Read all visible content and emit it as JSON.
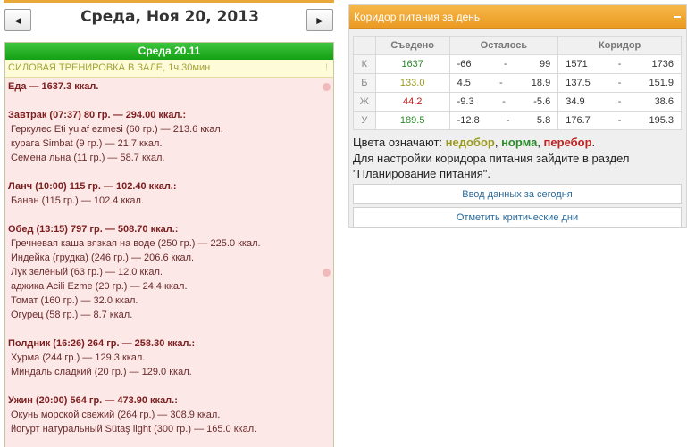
{
  "nav": {
    "prev_label": "◄",
    "next_label": "►",
    "date_title": "Среда, Ноя 20, 2013"
  },
  "day": {
    "header": "Среда 20.11",
    "workout": "СИЛОВАЯ ТРЕНИРОВКА В ЗАЛЕ, 1ч 30мин",
    "workout_mark": "!",
    "total": "Еда — 1637.3 ккал.",
    "meals": [
      {
        "title": "Завтрак (07:37) 80 гр. — 294.00 ккал.:",
        "items": [
          "Геркулес Eti yulaf ezmesi (60 гр.) — 213.6 ккал.",
          "курага Simbat (9 гр.) — 21.7 ккал.",
          "Семена льна (11 гр.) — 58.7 ккал."
        ]
      },
      {
        "title": "Ланч (10:00) 115 гр. — 102.40 ккал.:",
        "items": [
          "Банан (115 гр.) — 102.4 ккал."
        ]
      },
      {
        "title": "Обед (13:15) 797 гр. — 508.70 ккал.:",
        "items": [
          "Гречневая каша вязкая на воде (250 гр.) — 225.0 ккал.",
          "Индейка (грудка) (246 гр.) — 206.6 ккал.",
          "Лук зелёный (63 гр.) — 12.0 ккал.",
          "аджика Acili Ezme (20 гр.) — 24.4 ккал.",
          "Томат (160 гр.) — 32.0 ккал.",
          "Огурец (58 гр.) — 8.7 ккал."
        ]
      },
      {
        "title": "Полдник (16:26) 264 гр. — 258.30 ккал.:",
        "items": [
          "Хурма (244 гр.) — 129.3 ккал.",
          "Миндаль сладкий (20 гр.) — 129.0 ккал."
        ]
      },
      {
        "title": "Ужин (20:00) 564 гр. — 473.90 ккал.:",
        "items": [
          "Окунь морской свежий (264 гр.) — 308.9 ккал.",
          "йогурт натуральный Sütaş light (300 гр.) — 165.0 ккал."
        ]
      }
    ]
  },
  "corridor": {
    "title": "Коридор питания за день",
    "headers": {
      "eaten": "Съедено",
      "remaining": "Осталось",
      "corridor": "Коридор"
    },
    "rows": [
      {
        "label": "К",
        "eaten": "1637",
        "eaten_color": "#2a8a2a",
        "rem_min": "-66",
        "rem_max": "99",
        "cor_min": "1571",
        "cor_max": "1736"
      },
      {
        "label": "Б",
        "eaten": "133.0",
        "eaten_color": "#9a9a20",
        "rem_min": "4.5",
        "rem_max": "18.9",
        "cor_min": "137.5",
        "cor_max": "151.9"
      },
      {
        "label": "Ж",
        "eaten": "44.2",
        "eaten_color": "#c02020",
        "rem_min": "-9.3",
        "rem_max": "-5.6",
        "cor_min": "34.9",
        "cor_max": "38.6"
      },
      {
        "label": "У",
        "eaten": "189.5",
        "eaten_color": "#2a8a2a",
        "rem_min": "-12.8",
        "rem_max": "5.8",
        "cor_min": "176.7",
        "cor_max": "195.3"
      }
    ],
    "dash": "-",
    "legend": {
      "prefix": "Цвета означают: ",
      "under": "недобор",
      "sep1": ", ",
      "norm": "норма",
      "sep2": ", ",
      "over": "перебор",
      "end": "."
    },
    "info_line1": "Для настройки коридора питания зайдите в раздел",
    "info_line2": "\"Планирование питания\".",
    "enter_data_label": "Ввод данных за сегодня",
    "critical_days_label": "Отметить критические дни"
  }
}
